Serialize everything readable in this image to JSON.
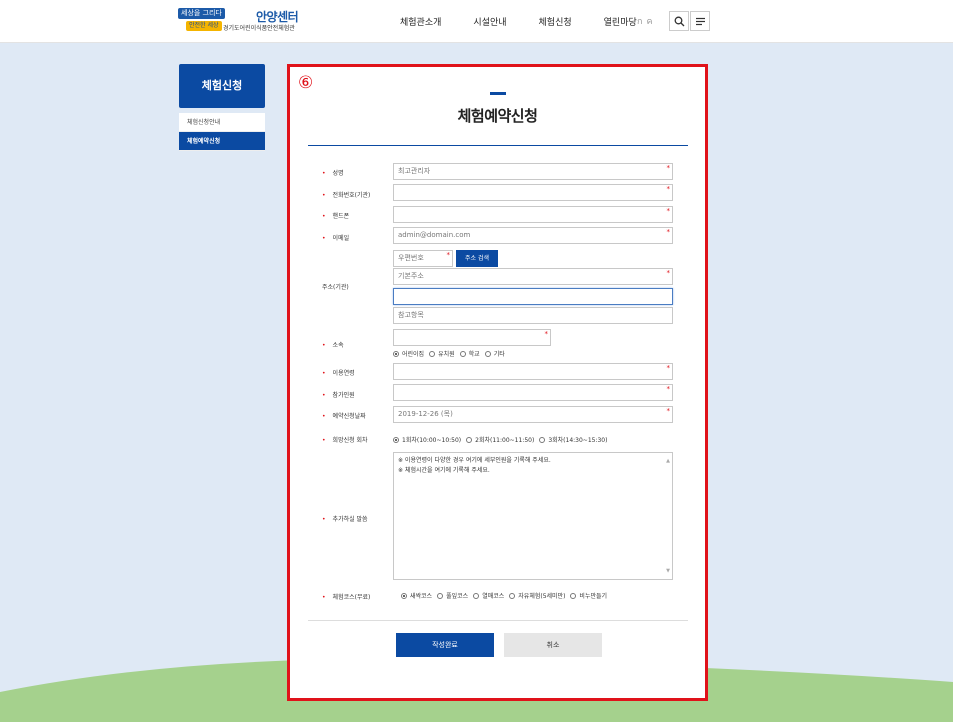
{
  "header": {
    "logo": {
      "badge1": "세상을 그리다",
      "badge2": "안전한 세상",
      "main": "안양센터",
      "sub": "경기도어린이식품안전체험관"
    },
    "nav": [
      "체험관소개",
      "시설안내",
      "체험신청",
      "열린마당"
    ],
    "util": [
      "ก",
      "ค"
    ]
  },
  "sidebar": {
    "title": "체험신청",
    "items": [
      {
        "label": "체험신청안내"
      },
      {
        "label": "체험예약신청"
      }
    ]
  },
  "panel": {
    "marker": "⑥",
    "title": "체험예약신청",
    "fields": {
      "name": {
        "label": "성명",
        "value": "최고관리자"
      },
      "phone": {
        "label": "전화번호(기관)",
        "value": ""
      },
      "mobile": {
        "label": "핸드폰",
        "value": ""
      },
      "email": {
        "label": "이메일",
        "value": "admin@domain.com"
      },
      "address": {
        "label": "주소(기관)",
        "zip_placeholder": "우편번호",
        "search_button": "주소 검색",
        "base_placeholder": "기본주소",
        "detail_value": "",
        "ref_placeholder": "참고항목"
      },
      "affiliation": {
        "label": "소속",
        "value": "",
        "options": [
          "어린이집",
          "유치원",
          "학교",
          "기타"
        ]
      },
      "age": {
        "label": "이용연령",
        "value": ""
      },
      "participants": {
        "label": "참가인원",
        "value": ""
      },
      "date": {
        "label": "예약신청날짜",
        "value": "2019-12-26 (목)"
      },
      "session": {
        "label": "희망신청 회차",
        "options": [
          "1회차(10:00~10:50)",
          "2회차(11:00~11:50)",
          "3회차(14:30~15:30)"
        ]
      },
      "comment": {
        "label": "추가하실 말씀",
        "lines": [
          "※ 이용연령이 다양한 경우 여기에 세부인원을 기록해 주세요.",
          "※ 체험시간을 여기에 기록해 주세요."
        ]
      },
      "course": {
        "label": "체험코스(무료)",
        "options": [
          "새싹코스",
          "풀잎코스",
          "열매코스",
          "자유체험(5세미만)",
          "비누만들기"
        ]
      }
    },
    "buttons": {
      "submit": "작성완료",
      "cancel": "취소"
    }
  }
}
